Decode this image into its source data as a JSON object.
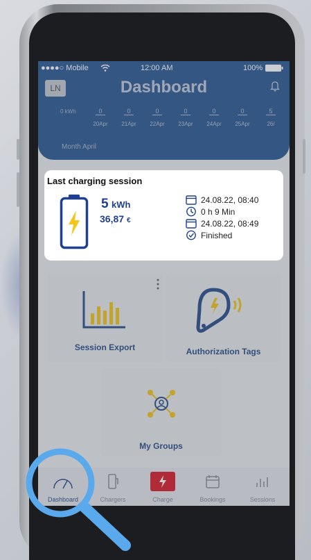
{
  "status_bar": {
    "carrier": "●●●●○ Mobile",
    "time": "12:00 AM",
    "battery": "100%"
  },
  "header": {
    "avatar_initials": "LN",
    "title": "Dashboard",
    "kwh_axis": "0 kWh",
    "month_label": "Month April",
    "bars": [
      {
        "value": "0",
        "date": "20Apr"
      },
      {
        "value": "0",
        "date": "21Apr"
      },
      {
        "value": "0",
        "date": "22Apr"
      },
      {
        "value": "0",
        "date": "23Apr"
      },
      {
        "value": "0",
        "date": "24Apr"
      },
      {
        "value": "0",
        "date": "25Apr"
      },
      {
        "value": "5",
        "date": "26/"
      }
    ]
  },
  "last_session": {
    "title": "Last charging session",
    "energy_value": "5",
    "energy_unit": "kWh",
    "price_value": "36,87",
    "price_unit": "€",
    "start": "24.08.22, 08:40",
    "duration": "0 h 9 Min",
    "end": "24.08.22, 08:49",
    "status": "Finished"
  },
  "tiles": {
    "session_export": "Session Export",
    "authorization_tags": "Authorization Tags",
    "my_groups": "My Groups"
  },
  "tabbar": {
    "dashboard": "Dashboard",
    "chargers": "Chargers",
    "charge": "Charge",
    "bookings": "Bookings",
    "sessions": "Sessions"
  },
  "colors": {
    "header_blue": "#2f5a94",
    "brand_blue": "#1f3f8f",
    "accent_yellow": "#f5c518",
    "charge_red": "#d81f2a",
    "magnifier_blue": "#5aa9ec"
  }
}
